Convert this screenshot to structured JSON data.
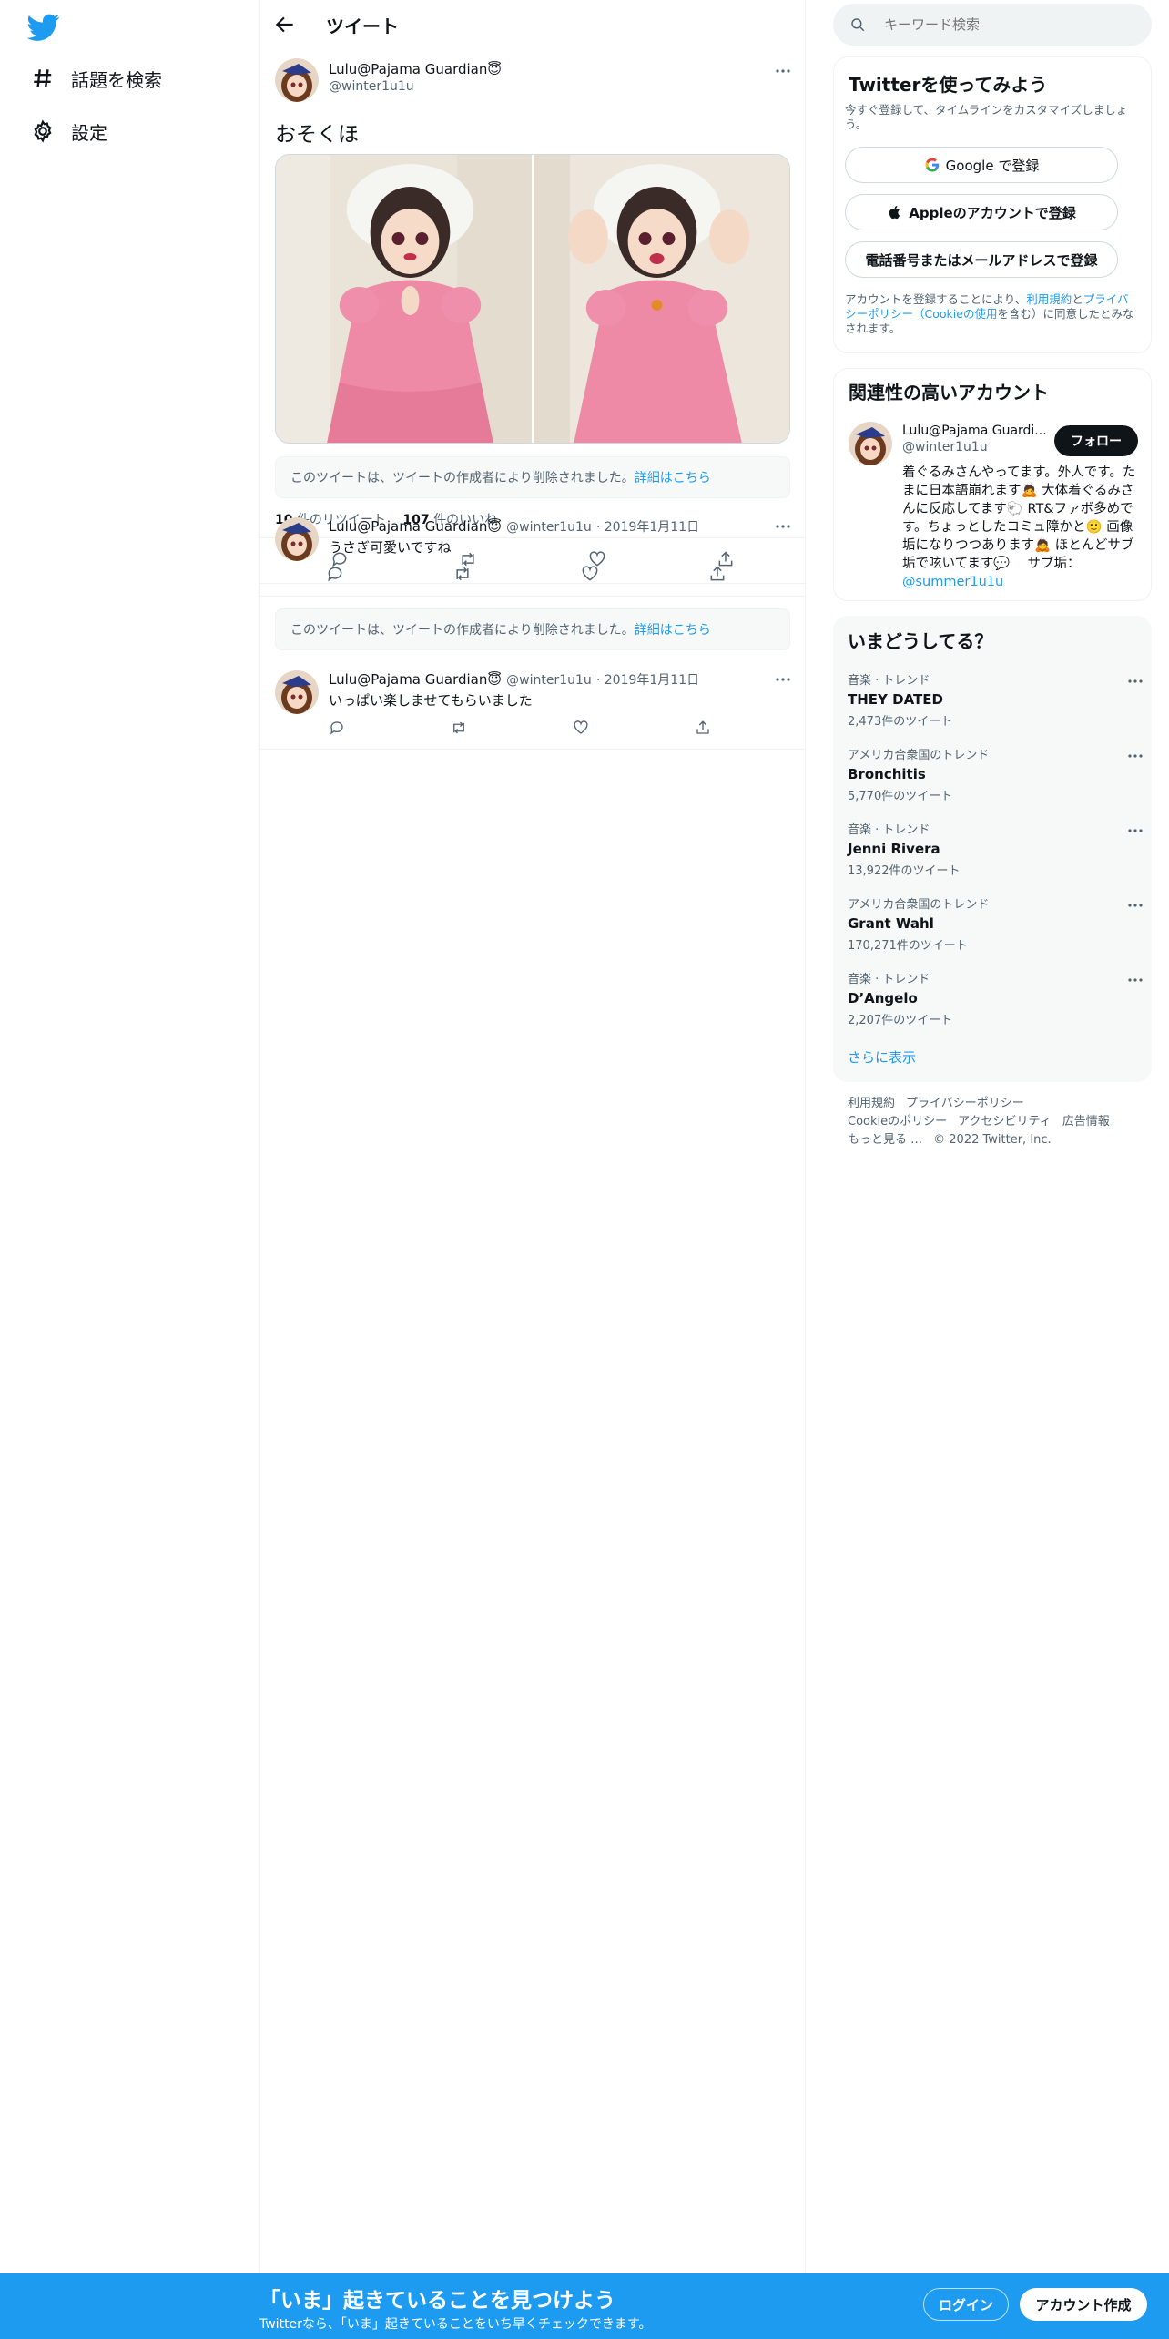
{
  "nav": {
    "explore_label": "話題を検索",
    "settings_label": "設定"
  },
  "header": {
    "title": "ツイート"
  },
  "main_tweet": {
    "name": "Lulu@Pajama Guardian😇",
    "handle": "@winter1u1u",
    "text": "おそくほ",
    "deleted_notice": "このツイートは、ツイートの作成者により削除されました。",
    "deleted_link": "詳細はこちら",
    "retweets_count": "10",
    "retweets_label": "件のリツイート",
    "likes_count": "107",
    "likes_label": "件のいいね"
  },
  "replies": [
    {
      "name": "Lulu@Pajama Guardian😇",
      "handle": "@winter1u1u",
      "date": "· 2019年1月11日",
      "text": "うさぎ可愛いですね"
    },
    {
      "name": "Lulu@Pajama Guardian😇",
      "handle": "@winter1u1u",
      "date": "· 2019年1月11日",
      "text": "いっぱい楽しませてもらいました"
    }
  ],
  "search": {
    "placeholder": "キーワード検索"
  },
  "signup_panel": {
    "title": "Twitterを使ってみよう",
    "subtitle": "今すぐ登録して、タイムラインをカスタマイズしましょう。",
    "google_label": "Google で登録",
    "apple_label": "Appleのアカウントで登録",
    "phone_label": "電話番号またはメールアドレスで登録",
    "terms_prefix": "アカウントを登録することにより、",
    "terms_link": "利用規約",
    "terms_and": "と",
    "privacy_link": "プライバシーポリシー",
    "cookie_link": "（Cookieの使用",
    "terms_suffix": "を含む）に同意したとみなされます。"
  },
  "related_panel": {
    "title": "関連性の高いアカウント",
    "name": "Lulu@Pajama Guardi...",
    "handle": "@winter1u1u",
    "follow_label": "フォロー",
    "bio": "着ぐるみさんやってます。外人です。たまに日本語崩れます🙇 大体着ぐるみさんに反応してます🐑 RT&ファボ多めです。ちょっとしたコミュ障かと🙂 画像垢になりつつあります🙇 ほとんどサブ垢で呟いてます💬　 サブ垢：",
    "bio_link": "@summer1u1u"
  },
  "trends_panel": {
    "title": "いまどうしてる？",
    "items": [
      {
        "context": "音楽 · トレンド",
        "name": "THEY DATED",
        "count": "2,473件のツイート"
      },
      {
        "context": "アメリカ合衆国のトレンド",
        "name": "Bronchitis",
        "count": "5,770件のツイート"
      },
      {
        "context": "音楽 · トレンド",
        "name": "Jenni Rivera",
        "count": "13,922件のツイート"
      },
      {
        "context": "アメリカ合衆国のトレンド",
        "name": "Grant Wahl",
        "count": "170,271件のツイート"
      },
      {
        "context": "音楽 · トレンド",
        "name": "D’Angelo",
        "count": "2,207件のツイート"
      }
    ],
    "show_more": "さらに表示"
  },
  "footer": {
    "terms": "利用規約",
    "privacy": "プライバシーポリシー",
    "cookie": "Cookieのポリシー",
    "accessibility": "アクセシビリティ",
    "ads": "広告情報",
    "more": "もっと見る …",
    "copyright": "© 2022 Twitter, Inc."
  },
  "bottom_bar": {
    "title": "「いま」起きていることを見つけよう",
    "subtitle": "Twitterなら、「いま」起きていることをいち早くチェックできます。",
    "login_label": "ログイン",
    "signup_label": "アカウント作成"
  },
  "colors": {
    "accent": "#1d9bf0",
    "text": "#0f1419",
    "secondary": "#536471"
  }
}
